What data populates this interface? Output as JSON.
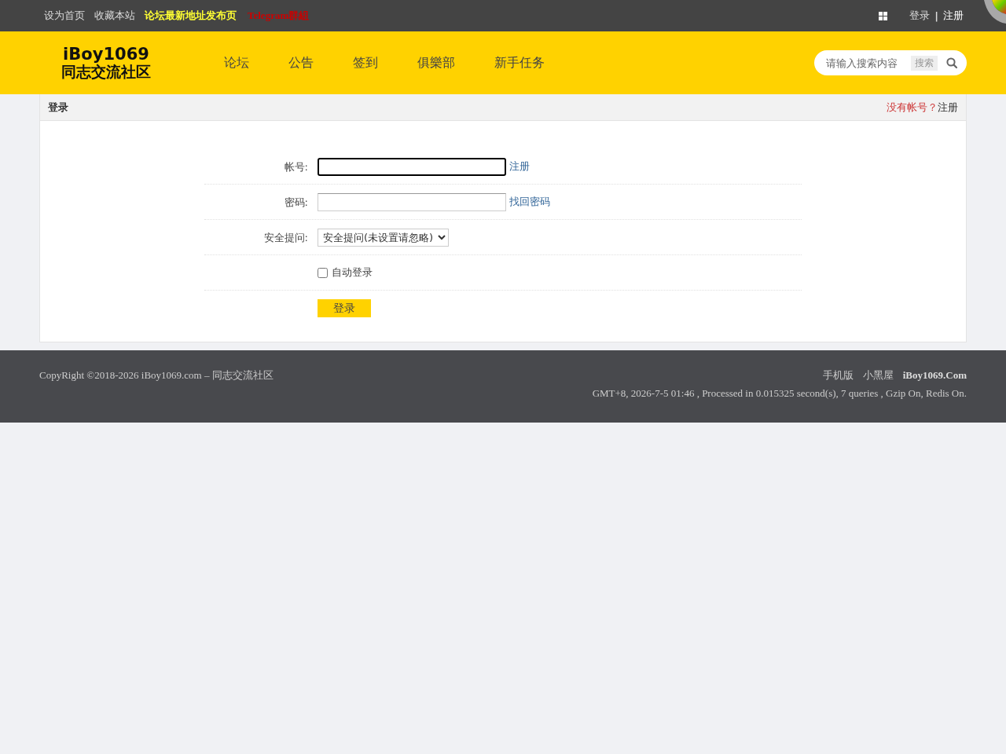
{
  "top_bar": {
    "links": [
      {
        "text": "设为首页",
        "kind": "plain"
      },
      {
        "text": "收藏本站",
        "kind": "plain"
      },
      {
        "text": "论坛最新地址发布页",
        "kind": "highlight"
      },
      {
        "text": "Telegram群組",
        "kind": "alert"
      }
    ],
    "login": "登录",
    "separator": "|",
    "register": "注册"
  },
  "header": {
    "logo": {
      "title": "iBoy1069",
      "subtitle": "同志交流社区"
    },
    "nav": [
      "论坛",
      "公告",
      "签到",
      "俱樂部",
      "新手任务"
    ],
    "search": {
      "placeholder": "请输入搜索内容",
      "button": "搜索"
    }
  },
  "panel": {
    "title": "登录",
    "no_account": "没有帐号？",
    "register": "注册"
  },
  "form": {
    "rows": [
      {
        "kind": "text",
        "label": "帐号:",
        "focused": true,
        "link": "注册"
      },
      {
        "kind": "password",
        "label": "密码:",
        "focused": false,
        "link": "找回密码"
      },
      {
        "kind": "select",
        "label": "安全提问:",
        "value": "安全提问(未设置请忽略)"
      },
      {
        "kind": "checkbox",
        "label": "自动登录",
        "checked": false
      },
      {
        "kind": "button",
        "label": "登录"
      }
    ]
  },
  "footer": {
    "copyright": "CopyRight ©2018-2026 iBoy1069.com – 同志交流社区",
    "links": [
      {
        "text": "手机版",
        "kind": "plain"
      },
      {
        "text": "小黑屋",
        "kind": "plain"
      },
      {
        "text": "iBoy1069.Com",
        "kind": "bold"
      }
    ],
    "stats": "GMT+8, 2026-7-5 01:46 , Processed in 0.015325 second(s), 7 queries , Gzip On, Redis On."
  }
}
